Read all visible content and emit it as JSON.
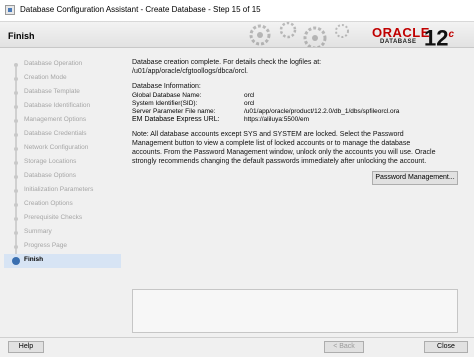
{
  "window": {
    "title": "Database Configuration Assistant - Create Database - Step 15 of 15"
  },
  "banner": {
    "page_title": "Finish",
    "logo_text": "ORACLE",
    "logo_sub": "DATABASE",
    "version": "12",
    "version_suffix": "c"
  },
  "steps": [
    {
      "label": "Database Operation",
      "state": "done"
    },
    {
      "label": "Creation Mode",
      "state": "done"
    },
    {
      "label": "Database Template",
      "state": "done"
    },
    {
      "label": "Database Identification",
      "state": "done"
    },
    {
      "label": "Management Options",
      "state": "done"
    },
    {
      "label": "Database Credentials",
      "state": "done"
    },
    {
      "label": "Network Configuration",
      "state": "done"
    },
    {
      "label": "Storage Locations",
      "state": "done"
    },
    {
      "label": "Database Options",
      "state": "done"
    },
    {
      "label": "Initialization Parameters",
      "state": "done"
    },
    {
      "label": "Creation Options",
      "state": "done"
    },
    {
      "label": "Prerequisite Checks",
      "state": "done"
    },
    {
      "label": "Summary",
      "state": "done"
    },
    {
      "label": "Progress Page",
      "state": "done"
    },
    {
      "label": "Finish",
      "state": "current"
    }
  ],
  "content": {
    "complete_line1": "Database creation complete. For details check the logfiles at:",
    "complete_line2": " /u01/app/oracle/cfgtoollogs/dbca/orcl.",
    "info_header": "Database Information:",
    "info": [
      {
        "label": "Global Database Name:",
        "value": "orcl"
      },
      {
        "label": "System Identifier(SID):",
        "value": "orcl"
      },
      {
        "label": "Server Parameter File name:",
        "value": "/u01/app/oracle/product/12.2.0/db_1/dbs/spfileorcl.ora"
      },
      {
        "label": "EM Database Express URL:",
        "value": "https://aliluya:5500/em"
      }
    ],
    "note_lines": [
      "Note: All database accounts except SYS and SYSTEM are locked. Select the Password",
      "Management button to view a complete list of locked accounts or to manage the database",
      "accounts. From the Password Management window, unlock only the accounts you will use. Oracle",
      "strongly recommends changing the default passwords immediately after unlocking the account."
    ],
    "password_button": "Password Management..."
  },
  "footer": {
    "help_label": "Help",
    "back_label": "< Back",
    "close_label": "Close"
  },
  "colors": {
    "oracle_red": "#c00000",
    "current_step_bg": "#d7e4f4"
  }
}
